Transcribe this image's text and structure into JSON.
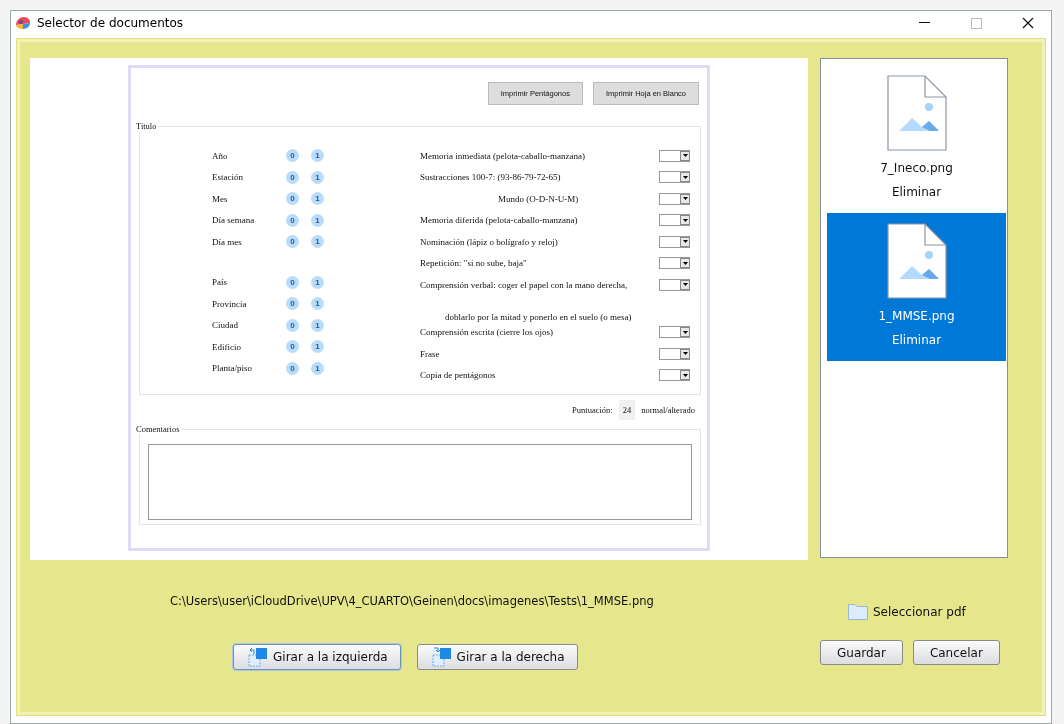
{
  "window": {
    "title": "Selector de documentos"
  },
  "document": {
    "print_buttons": [
      "Imprimir Pentágonos",
      "Imprimir Hoja en Blanco"
    ],
    "section_title": "Titulo",
    "left_groups": [
      [
        {
          "label": "Año",
          "options": [
            "0",
            "1"
          ]
        },
        {
          "label": "Estación",
          "options": [
            "0",
            "1"
          ]
        },
        {
          "label": "Mes",
          "options": [
            "0",
            "1"
          ]
        },
        {
          "label": "Día semana",
          "options": [
            "0",
            "1"
          ]
        },
        {
          "label": "Día mes",
          "options": [
            "0",
            "1"
          ]
        }
      ],
      [
        {
          "label": "País",
          "options": [
            "0",
            "1"
          ]
        },
        {
          "label": "Provincia",
          "options": [
            "0",
            "1"
          ]
        },
        {
          "label": "Ciudad",
          "options": [
            "0",
            "1"
          ]
        },
        {
          "label": "Edificio",
          "options": [
            "0",
            "1"
          ]
        },
        {
          "label": "Planta/piso",
          "options": [
            "0",
            "1"
          ]
        }
      ]
    ],
    "right_rows": [
      {
        "kind": "select",
        "text": "Memoria inmediata (pelota-caballo-manzana)"
      },
      {
        "kind": "select",
        "text": "Sustracciones 100-7:  (93-86-79-72-65)"
      },
      {
        "kind": "subselect",
        "text": "Mundo (O-D-N-U-M)"
      },
      {
        "kind": "select",
        "text": "Memoria diferida (pelota-caballo-manzana)"
      },
      {
        "kind": "select",
        "text": "Nominación (lápiz o bolígrafo y reloj)"
      },
      {
        "kind": "select",
        "text": "Repetición: \"si no sube, baja\""
      },
      {
        "kind": "select",
        "text": "Comprensión verbal: coger el papel con la mano derecha,"
      },
      {
        "kind": "note",
        "text": "doblarlo por la mitad y ponerlo en el suelo (o mesa)"
      },
      {
        "kind": "select",
        "text": "Comprensión escrita (cierre los ojos)"
      },
      {
        "kind": "select",
        "text": "Frase"
      },
      {
        "kind": "select",
        "text": "Copia de pentágonos"
      }
    ],
    "score_label": "Puntuación:",
    "score": "24",
    "score_note": "normal/alterado",
    "comments_title": "Comentarios"
  },
  "path": "C:\\Users\\user\\iCloudDrive\\UPV\\4_CUARTO\\Geinen\\docs\\imagenes\\Tests\\1_MMSE.png",
  "rotate_buttons": [
    {
      "kind": "left",
      "label": "Girar a la izquierda",
      "selected": true
    },
    {
      "kind": "right",
      "label": "Girar a la derecha",
      "selected": false
    }
  ],
  "files": [
    {
      "name": "7_Ineco.png",
      "action": "Eliminar",
      "selected": false
    },
    {
      "name": "1_MMSE.png",
      "action": "Eliminar",
      "selected": true
    }
  ],
  "select_pdf": "Seleccionar pdf",
  "buttons": [
    "Guardar",
    "Cancelar"
  ]
}
